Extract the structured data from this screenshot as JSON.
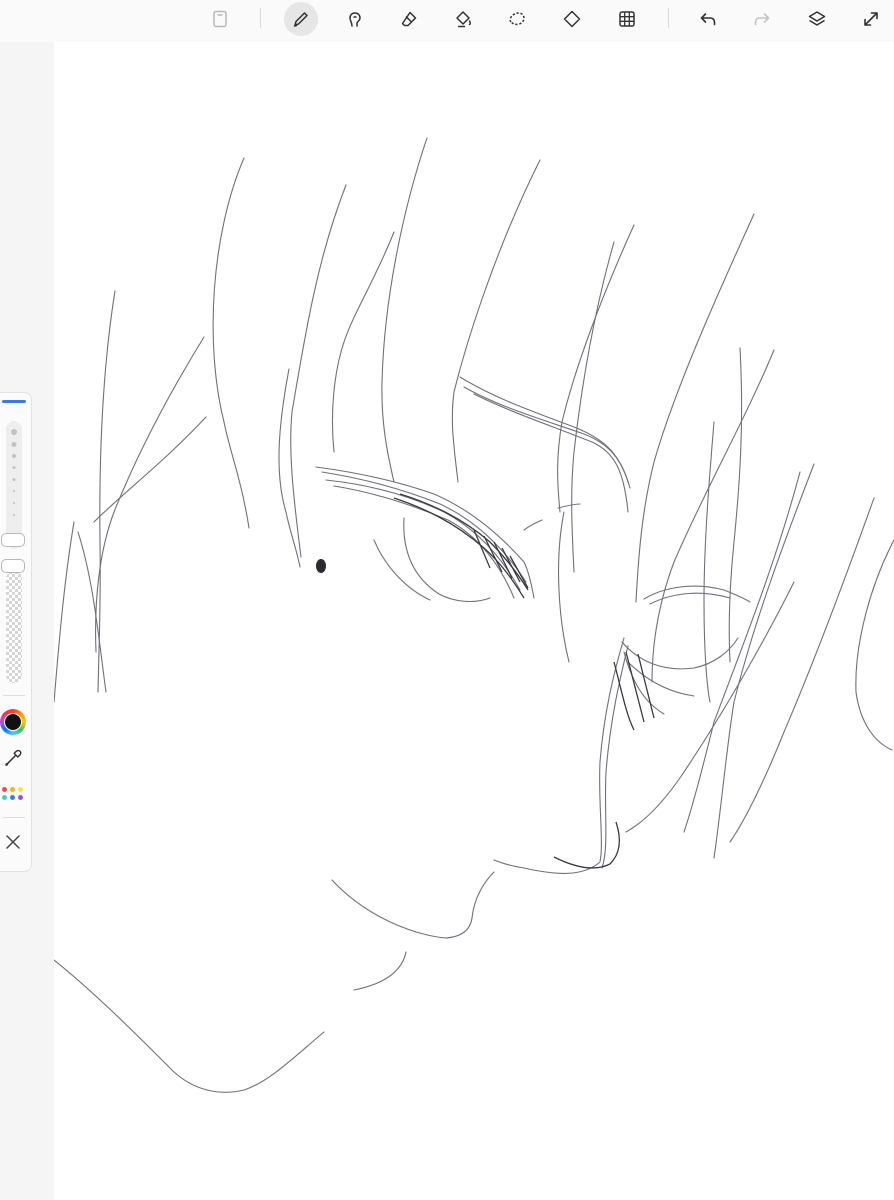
{
  "app": {
    "toolbar": {
      "tools": [
        {
          "name": "document-icon",
          "state": "default"
        },
        {
          "name": "brush-icon",
          "state": "active"
        },
        {
          "name": "smudge-icon",
          "state": "default"
        },
        {
          "name": "eraser-icon",
          "state": "default"
        },
        {
          "name": "fill-bucket-icon",
          "state": "default"
        },
        {
          "name": "lasso-select-icon",
          "state": "default"
        },
        {
          "name": "transform-icon",
          "state": "default"
        },
        {
          "name": "grid-icon",
          "state": "default"
        },
        {
          "name": "undo-icon",
          "state": "default"
        },
        {
          "name": "redo-icon",
          "state": "disabled"
        },
        {
          "name": "layers-icon",
          "state": "default"
        },
        {
          "name": "fullscreen-icon",
          "state": "default"
        }
      ]
    },
    "brush_panel": {
      "current_color": "#111111",
      "accent_color": "#3a7bdc",
      "swatches": [
        "#ff4a3d",
        "#ffb020",
        "#ffe433",
        "#3fd1c9",
        "#3b7bf0",
        "#a24be8"
      ]
    },
    "canvas": {
      "background": "#ffffff",
      "stroke_color": "#6d6d72"
    }
  }
}
